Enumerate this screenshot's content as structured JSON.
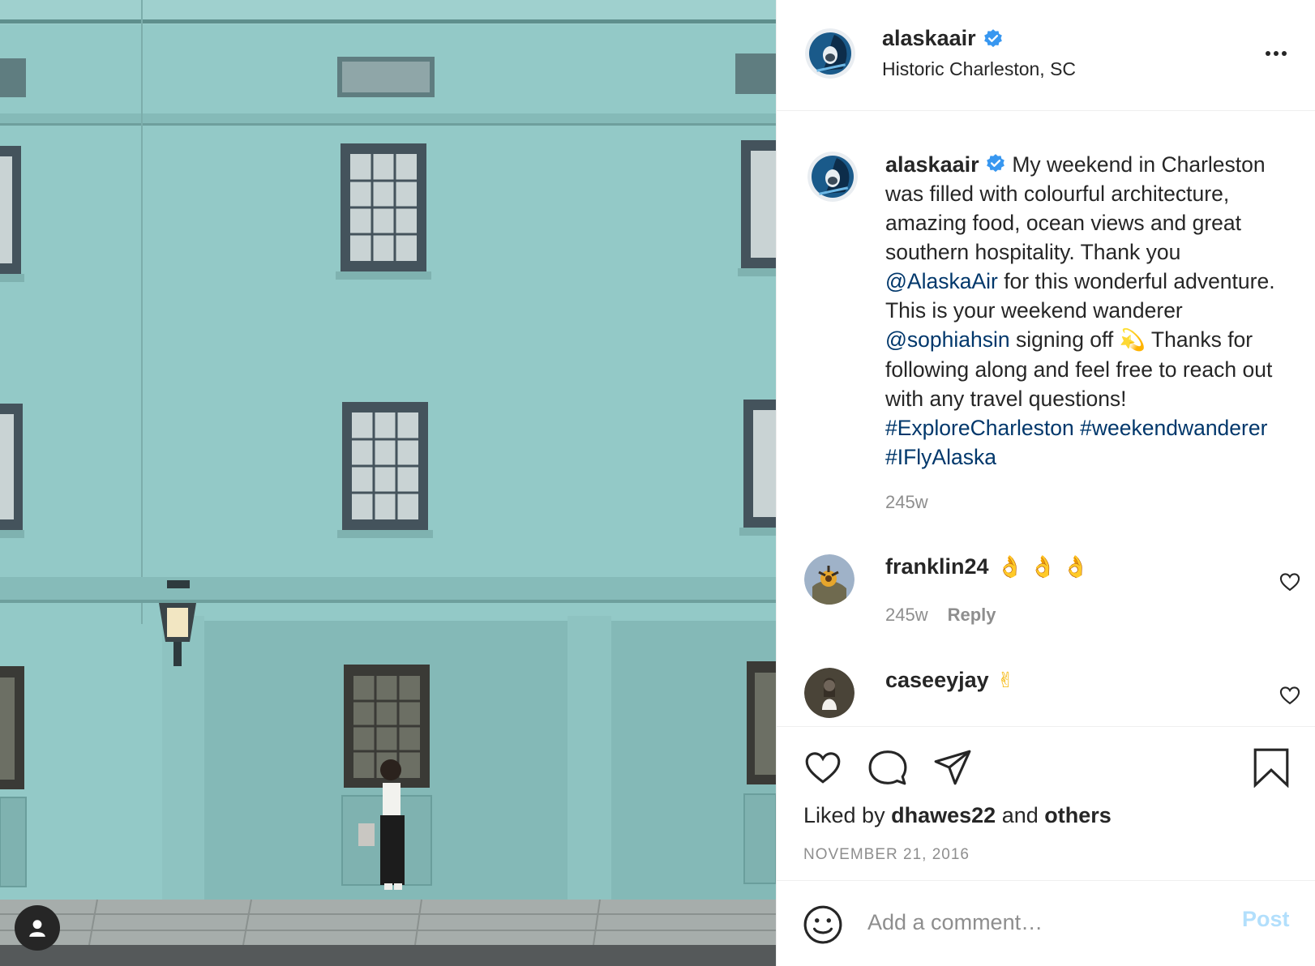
{
  "post": {
    "username": "alaskaair",
    "location": "Historic Charleston, SC",
    "caption": {
      "username": "alaskaair",
      "text_1": "My weekend in Charleston was filled with colourful architecture, amazing food, ocean views and great southern hospitality. Thank you ",
      "mention_1": "@AlaskaAir",
      "text_2": " for this wonderful adventure. This is your weekend wanderer ",
      "mention_2": "@sophiahsin",
      "text_3": " signing off ",
      "emoji": "💫",
      "text_4": " Thanks for following along and feel free to reach out with any travel questions! ",
      "hashtag_1": "#ExploreCharleston",
      "hashtag_2": "#weekendwanderer",
      "hashtag_3": "#IFlyAlaska",
      "time": "245w"
    },
    "comments": [
      {
        "username": "franklin24",
        "emoji": "👌 👌 👌",
        "time": "245w",
        "reply_label": "Reply"
      },
      {
        "username": "caseeyjay",
        "emoji": "✌"
      }
    ],
    "liked_by_prefix": "Liked by",
    "liked_by_user": "dhawes22",
    "liked_by_and": "and",
    "liked_by_others": "others",
    "date": "NOVEMBER 21, 2016",
    "comment_placeholder": "Add a comment…",
    "post_label": "Post"
  },
  "icons": {
    "verified": "verified-badge-icon",
    "more": "more-options-icon",
    "like": "heart-icon",
    "comment": "speech-bubble-icon",
    "share": "paper-plane-icon",
    "save": "bookmark-icon",
    "emoji": "smiley-icon",
    "user_tag": "person-icon"
  },
  "colors": {
    "link": "#00376b",
    "verified": "#3897f0",
    "post_button_disabled": "#b2dffc",
    "secondary_text": "#8e8e8e",
    "wall": "#8ec4c3"
  }
}
